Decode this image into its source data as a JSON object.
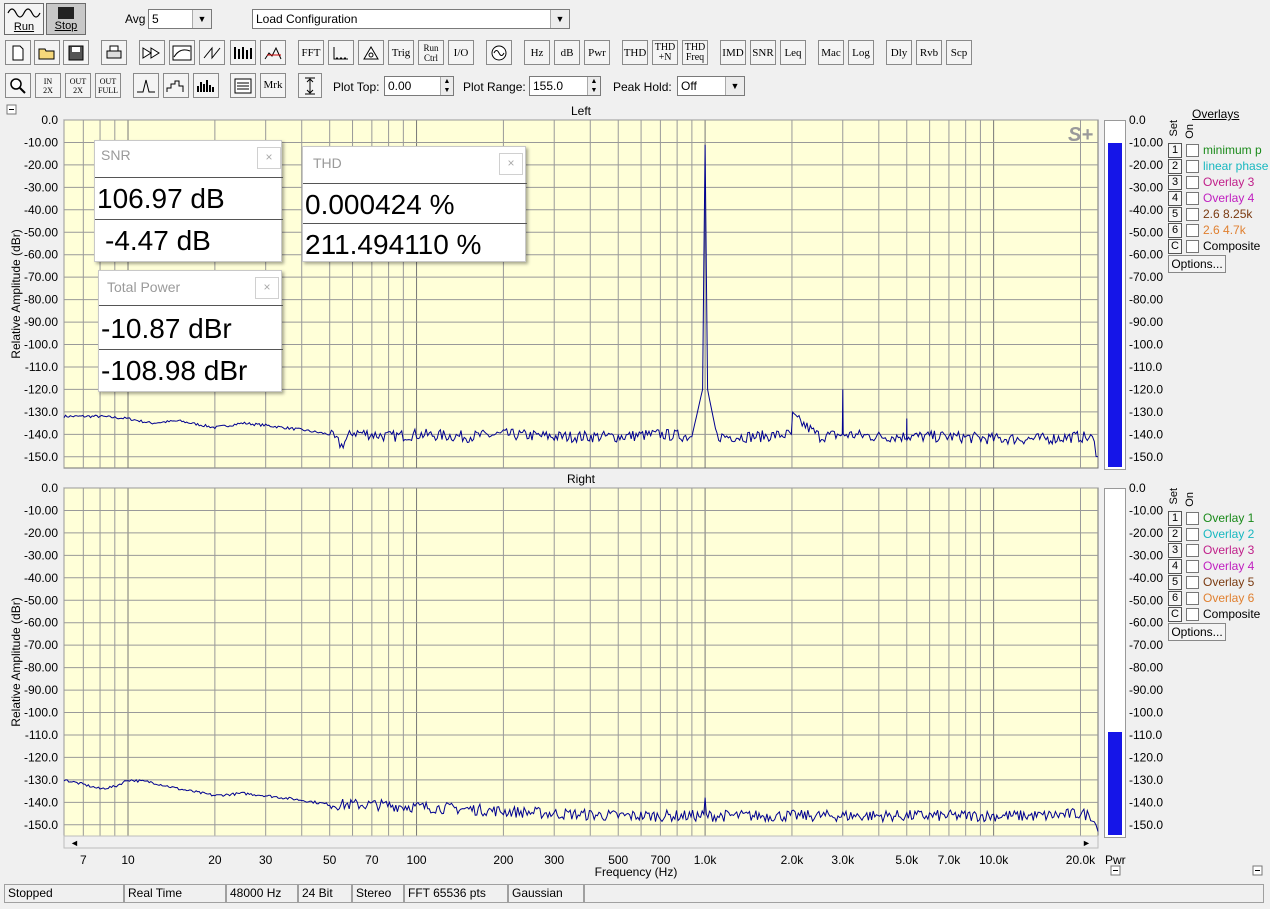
{
  "toolbar": {
    "run_label": "Run",
    "stop_label": "Stop",
    "avg_label": "Avg",
    "avg_value": "5",
    "config_value": "Load Configuration",
    "buttons": [
      "FFT",
      "Trig",
      "Run Ctrl",
      "I/O",
      "Hz",
      "dB",
      "Pwr",
      "THD",
      "THD +N",
      "THD Freq",
      "IMD",
      "SNR",
      "Leq",
      "Mac",
      "Log",
      "Dly",
      "Rvb",
      "Scp"
    ],
    "row2_buttons": [
      "Mrk"
    ],
    "plot_top_label": "Plot Top:",
    "plot_top_value": "0.00",
    "plot_range_label": "Plot Range:",
    "plot_range_value": "155.0",
    "peak_hold_label": "Peak Hold:",
    "peak_hold_value": "Off"
  },
  "overlays": {
    "title": "Overlays",
    "set_label": "Set",
    "on_label": "On",
    "left": [
      {
        "n": "1",
        "name": "minimum p",
        "color": "#1a8a1a"
      },
      {
        "n": "2",
        "name": "linear phase",
        "color": "#18b8c0"
      },
      {
        "n": "3",
        "name": "Overlay 3",
        "color": "#c0208a"
      },
      {
        "n": "4",
        "name": "Overlay 4",
        "color": "#c020c0"
      },
      {
        "n": "5",
        "name": "2.6 8.25k",
        "color": "#7a3a10"
      },
      {
        "n": "6",
        "name": "2.6 4.7k",
        "color": "#e08030"
      },
      {
        "n": "C",
        "name": "Composite",
        "color": "#000000"
      }
    ],
    "right": [
      {
        "n": "1",
        "name": "Overlay 1",
        "color": "#1a8a1a"
      },
      {
        "n": "2",
        "name": "Overlay 2",
        "color": "#18b8c0"
      },
      {
        "n": "3",
        "name": "Overlay 3",
        "color": "#c0208a"
      },
      {
        "n": "4",
        "name": "Overlay 4",
        "color": "#c020c0"
      },
      {
        "n": "5",
        "name": "Overlay 5",
        "color": "#7a3a10"
      },
      {
        "n": "6",
        "name": "Overlay 6",
        "color": "#e08030"
      },
      {
        "n": "C",
        "name": "Composite",
        "color": "#000000"
      }
    ],
    "options_label": "Options..."
  },
  "meters": {
    "snr": {
      "title": "SNR",
      "v1": "106.97 dB",
      "v2": "-4.47 dB"
    },
    "thd": {
      "title": "THD",
      "v1": "0.000424 %",
      "v2": "211.494110 %"
    },
    "power": {
      "title": "Total Power",
      "v1": "-10.87 dBr",
      "v2": "-108.98 dBr"
    },
    "close": "×"
  },
  "status": {
    "state": "Stopped",
    "mode": "Real Time",
    "rate": "48000 Hz",
    "bits": "24 Bit",
    "channels": "Stereo",
    "fft": "FFT 65536 pts",
    "window": "Gaussian"
  },
  "chart_data": [
    {
      "type": "line",
      "title": "Left",
      "xlabel": "Frequency (Hz)",
      "ylabel": "Relative Amplitude (dBr)",
      "x_scale": "log",
      "xlim": [
        6,
        23000
      ],
      "ylim": [
        -155,
        0
      ],
      "x_tick_labels": [
        "7",
        "10",
        "20",
        "30",
        "50",
        "70",
        "100",
        "200",
        "300",
        "500",
        "700",
        "1.0k",
        "2.0k",
        "3.0k",
        "5.0k",
        "7.0k",
        "10.0k",
        "20.0k"
      ],
      "y_ticks": [
        0,
        -10,
        -20,
        -30,
        -40,
        -50,
        -60,
        -70,
        -80,
        -90,
        -100,
        -110,
        -120,
        -130,
        -140,
        -150
      ],
      "y_tick_labels": [
        "0.0",
        "-10.00",
        "-20.00",
        "-30.00",
        "-40.00",
        "-50.00",
        "-60.00",
        "-70.00",
        "-80.00",
        "-90.00",
        "-100.0",
        "-110.0",
        "-120.0",
        "-130.0",
        "-140.0",
        "-150.0"
      ],
      "grid": true,
      "noise_floor_db": -140,
      "x": [
        6,
        8,
        10,
        12,
        15,
        20,
        25,
        30,
        40,
        50,
        55,
        60,
        70,
        80,
        100,
        150,
        200,
        300,
        500,
        700,
        900,
        980,
        1000,
        1020,
        1100,
        1500,
        1990,
        2010,
        2500,
        2990,
        3000,
        3010,
        4000,
        4990,
        5000,
        5010,
        7000,
        10000,
        15000,
        20000,
        22000,
        23000
      ],
      "y": [
        -132,
        -132,
        -133,
        -135,
        -134,
        -137,
        -135,
        -136,
        -138,
        -140,
        -145,
        -139,
        -140,
        -141,
        -140,
        -141,
        -140,
        -141,
        -141,
        -140,
        -141,
        -120,
        -11,
        -120,
        -141,
        -141,
        -140,
        -132,
        -141,
        -140,
        -120,
        -140,
        -141,
        -141,
        -131,
        -141,
        -141,
        -142,
        -142,
        -141,
        -142,
        -150
      ],
      "meter_bar_db": -10.87
    },
    {
      "type": "line",
      "title": "Right",
      "xlabel": "Frequency (Hz)",
      "ylabel": "Relative Amplitude (dBr)",
      "x_scale": "log",
      "xlim": [
        6,
        23000
      ],
      "ylim": [
        -155,
        0
      ],
      "x_tick_labels": [
        "7",
        "10",
        "20",
        "30",
        "50",
        "70",
        "100",
        "200",
        "300",
        "500",
        "700",
        "1.0k",
        "2.0k",
        "3.0k",
        "5.0k",
        "7.0k",
        "10.0k",
        "20.0k"
      ],
      "y_ticks": [
        0,
        -10,
        -20,
        -30,
        -40,
        -50,
        -60,
        -70,
        -80,
        -90,
        -100,
        -110,
        -120,
        -130,
        -140,
        -150
      ],
      "y_tick_labels": [
        "0.0",
        "-10.00",
        "-20.00",
        "-30.00",
        "-40.00",
        "-50.00",
        "-60.00",
        "-70.00",
        "-80.00",
        "-90.00",
        "-100.0",
        "-110.0",
        "-120.0",
        "-130.0",
        "-140.0",
        "-150.0"
      ],
      "grid": true,
      "x": [
        6,
        7,
        8,
        9,
        10,
        12,
        15,
        20,
        25,
        30,
        40,
        50,
        70,
        100,
        150,
        200,
        300,
        500,
        700,
        990,
        1000,
        1010,
        1500,
        2000,
        3000,
        5000,
        7000,
        10000,
        15000,
        20000,
        22000,
        23000
      ],
      "y": [
        -130,
        -132,
        -134,
        -133,
        -130,
        -131,
        -134,
        -137,
        -136,
        -137,
        -139,
        -141,
        -141,
        -142,
        -143,
        -144,
        -145,
        -146,
        -146,
        -146,
        -139,
        -146,
        -146,
        -146,
        -146,
        -146,
        -146,
        -146,
        -146,
        -145,
        -146,
        -153
      ],
      "meter_bar_db": -108.98
    }
  ]
}
